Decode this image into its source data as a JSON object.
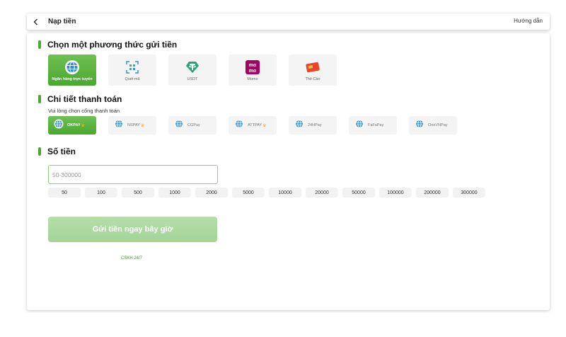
{
  "header": {
    "title": "Nạp tiền",
    "help_label": "Hướng dẫn"
  },
  "section_method": {
    "title": "Chọn một phương thức gửi tiền",
    "methods": [
      {
        "label": "Ngân hàng trực tuyến",
        "icon": "bank-globe-icon",
        "active": true
      },
      {
        "label": "Quét mã",
        "icon": "qr-scan-icon",
        "active": false
      },
      {
        "label": "USDT",
        "icon": "usdt-icon",
        "active": false
      },
      {
        "label": "Momo",
        "icon": "momo-icon",
        "active": false
      },
      {
        "label": "Thẻ Cào",
        "icon": "scratch-card-icon",
        "active": false
      }
    ]
  },
  "section_payment": {
    "title": "Chi tiết thanh toán",
    "subtitle": "Vui lòng chọn cổng thanh toán",
    "gateways": [
      {
        "label": "OKPAY",
        "vip": true,
        "active": true
      },
      {
        "label": "NSPAY",
        "vip": true,
        "active": false
      },
      {
        "label": "CGPay",
        "vip": false,
        "active": false
      },
      {
        "label": "ATTPAY",
        "vip": true,
        "active": false
      },
      {
        "label": "24HPay",
        "vip": false,
        "active": false
      },
      {
        "label": "FaFaPay",
        "vip": false,
        "active": false
      },
      {
        "label": "OneVNPay",
        "vip": false,
        "active": false
      }
    ]
  },
  "section_amount": {
    "title": "Số tiền",
    "placeholder": "50-300000",
    "quick_amounts": [
      "50",
      "100",
      "500",
      "1000",
      "2000",
      "5000",
      "10000",
      "20000",
      "50000",
      "100000",
      "200000",
      "300000"
    ]
  },
  "submit_label": "Gửi tiền ngay bây giờ",
  "support_label": "CSKH 24/7",
  "colors": {
    "accent": "#4aa82e",
    "submit_disabled": "#a9d89c",
    "crown": "#f2b01e"
  }
}
